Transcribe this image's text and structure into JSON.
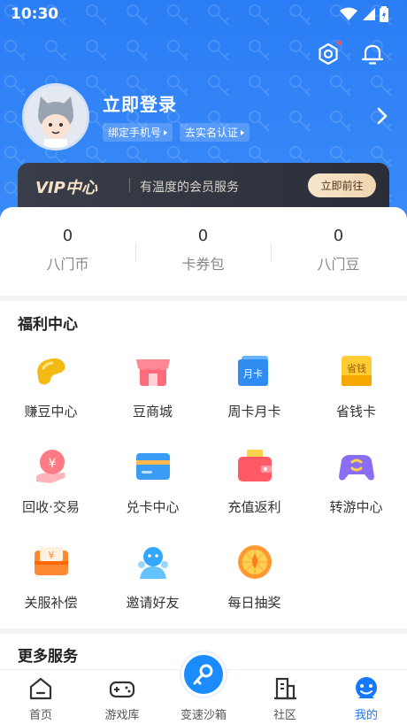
{
  "status": {
    "time": "10:30"
  },
  "profile": {
    "login_title": "立即登录",
    "bind_phone": "绑定手机号",
    "real_name": "去实名认证"
  },
  "vip": {
    "logo": "VIP中心",
    "desc": "有温度的会员服务",
    "button": "立即前往",
    "accent": "#f0d5ae"
  },
  "stats": [
    {
      "value": "0",
      "label": "八门币"
    },
    {
      "value": "0",
      "label": "卡券包"
    },
    {
      "value": "0",
      "label": "八门豆"
    }
  ],
  "welfare": {
    "title": "福利中心",
    "items": [
      {
        "label": "赚豆中心",
        "icon": "bean-icon"
      },
      {
        "label": "豆商城",
        "icon": "shop-icon"
      },
      {
        "label": "周卡月卡",
        "icon": "card-icon",
        "badge": "月卡"
      },
      {
        "label": "省钱卡",
        "icon": "saving-card-icon",
        "badge": "省钱"
      },
      {
        "label": "回收·交易",
        "icon": "yen-hand-icon"
      },
      {
        "label": "兑卡中心",
        "icon": "bank-card-icon"
      },
      {
        "label": "充值返利",
        "icon": "wallet-icon"
      },
      {
        "label": "转游中心",
        "icon": "gamepad-icon"
      },
      {
        "label": "关服补偿",
        "icon": "compensation-icon"
      },
      {
        "label": "邀请好友",
        "icon": "invite-friends-icon"
      },
      {
        "label": "每日抽奖",
        "icon": "lottery-wheel-icon"
      }
    ]
  },
  "more": {
    "title": "更多服务"
  },
  "tabs": [
    {
      "label": "首页",
      "icon": "home-icon"
    },
    {
      "label": "游戏库",
      "icon": "gamepad-outline-icon"
    },
    {
      "label": "变速沙箱",
      "icon": "key-icon"
    },
    {
      "label": "社区",
      "icon": "building-icon"
    },
    {
      "label": "我的",
      "icon": "smiley-icon"
    }
  ],
  "colors": {
    "primary": "#2b7df5",
    "active_tab": "#1677ff"
  }
}
